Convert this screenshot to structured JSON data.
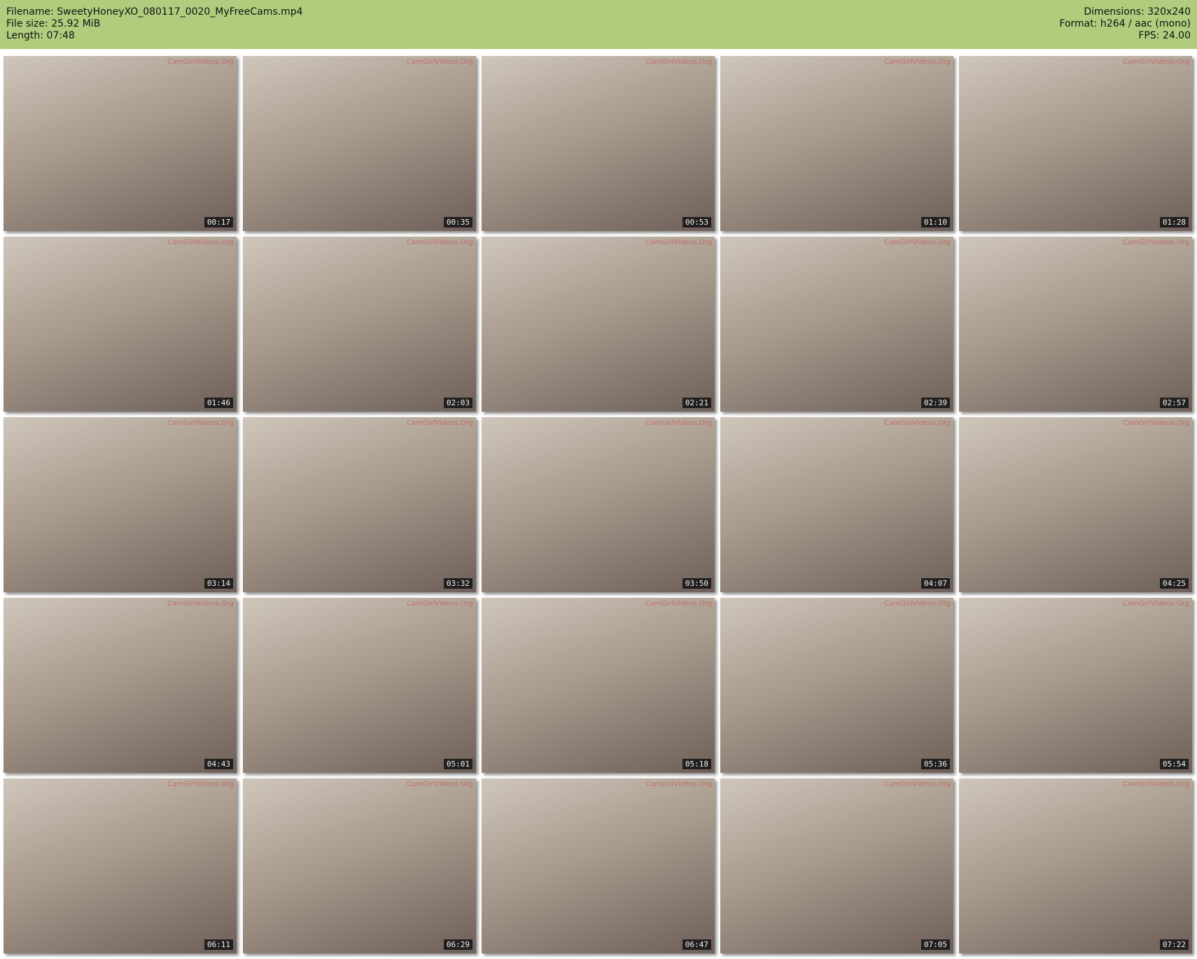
{
  "header": {
    "filename": "Filename: SweetyHoneyXO_080117_0020_MyFreeCams.mp4",
    "filesize": "File size: 25.92 MiB",
    "length": "Length: 07:48",
    "dimensions": "Dimensions: 320x240",
    "format": "Format: h264 / aac (mono)",
    "fps": "FPS: 24.00"
  },
  "watermark": "CamGirlVideos.Org",
  "colors": {
    "header_bg": "#b0cd7e"
  },
  "thumbnails": [
    "00:17",
    "00:35",
    "00:53",
    "01:10",
    "01:28",
    "01:46",
    "02:03",
    "02:21",
    "02:39",
    "02:57",
    "03:14",
    "03:32",
    "03:50",
    "04:07",
    "04:25",
    "04:43",
    "05:01",
    "05:18",
    "05:36",
    "05:54",
    "06:11",
    "06:29",
    "06:47",
    "07:05",
    "07:22"
  ]
}
